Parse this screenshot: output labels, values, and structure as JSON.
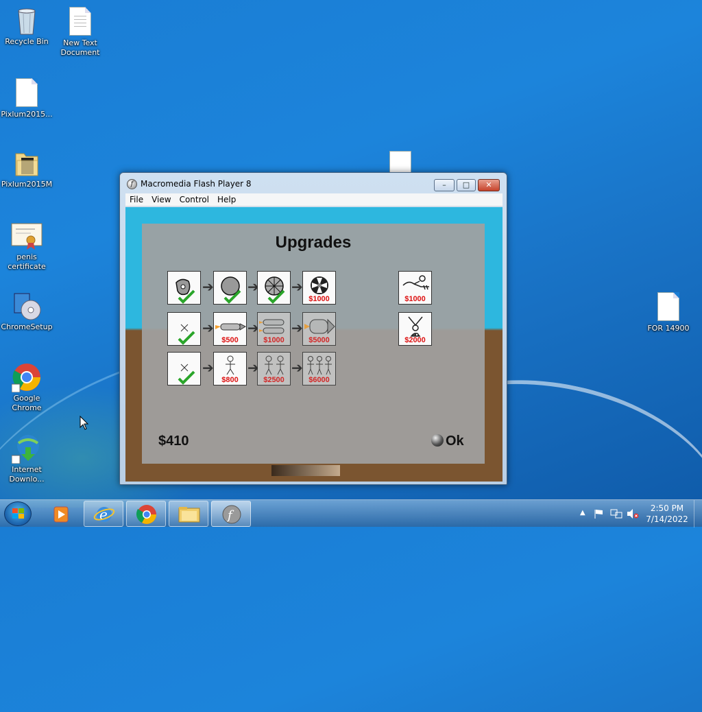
{
  "desktop": {
    "icons": [
      {
        "label": "Recycle Bin",
        "icon": "recycle-bin-icon"
      },
      {
        "label": "New Text Document",
        "icon": "text-document-icon"
      },
      {
        "label": "Pixlum2015...",
        "icon": "file-icon"
      },
      {
        "label": "Pixlum2015M",
        "icon": "folder-icon"
      },
      {
        "label": "penis certificate",
        "icon": "certificate-icon"
      },
      {
        "label": "ChromeSetup",
        "icon": "installer-icon"
      },
      {
        "label": "Google Chrome",
        "icon": "chrome-icon"
      },
      {
        "label": "Internet Downlo...",
        "icon": "internet-download-manager-icon"
      },
      {
        "label": "FOR 14900",
        "icon": "file-icon"
      }
    ]
  },
  "window": {
    "title": "Macromedia Flash Player 8",
    "menu": [
      "File",
      "View",
      "Control",
      "Help"
    ],
    "buttons": {
      "minimize": "–",
      "maximize": "□",
      "close": "✕"
    }
  },
  "game": {
    "heading": "Upgrades",
    "rows": [
      {
        "tiles": [
          {
            "icon": "shield-rock-icon",
            "status": "owned"
          },
          {
            "icon": "round-shield-icon",
            "status": "owned"
          },
          {
            "icon": "spiked-wheel-icon",
            "status": "owned"
          },
          {
            "icon": "fan-wheel-icon",
            "status": "available",
            "price": "$1000"
          }
        ]
      },
      {
        "tiles": [
          {
            "icon": "none-icon",
            "status": "owned"
          },
          {
            "icon": "single-rocket-icon",
            "status": "available",
            "price": "$500"
          },
          {
            "icon": "double-rocket-icon",
            "status": "locked",
            "price": "$1000"
          },
          {
            "icon": "big-rocket-icon",
            "status": "locked",
            "price": "$5000"
          }
        ]
      },
      {
        "tiles": [
          {
            "icon": "none-icon",
            "status": "owned"
          },
          {
            "icon": "one-person-icon",
            "status": "available",
            "price": "$800"
          },
          {
            "icon": "two-people-icon",
            "status": "locked",
            "price": "$2500"
          },
          {
            "icon": "three-people-icon",
            "status": "locked",
            "price": "$6000"
          }
        ]
      }
    ],
    "extras": [
      {
        "icon": "flying-person-icon",
        "price": "$1000"
      },
      {
        "icon": "bungee-person-icon",
        "price": "$2000"
      }
    ],
    "money": "$410",
    "ok_label": "Ok"
  },
  "taskbar": {
    "apps": [
      "media-player-icon",
      "internet-explorer-icon",
      "chrome-icon",
      "file-explorer-icon",
      "flash-player-icon"
    ],
    "time": "2:50 PM",
    "date": "7/14/2022"
  },
  "colors": {
    "accent_red": "#d11111",
    "check_green": "#2aa52a"
  }
}
